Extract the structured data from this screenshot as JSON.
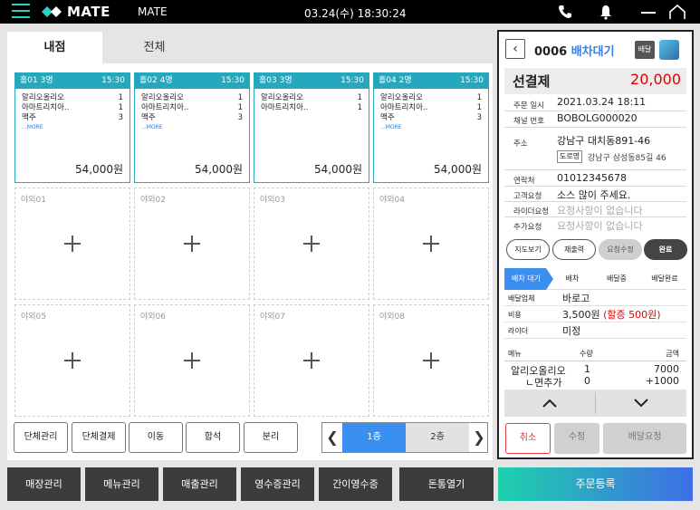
{
  "topbar": {
    "logo_text": "MATE",
    "store_name": "MATE",
    "datetime": "03.24(수) 18:30:24",
    "icons": [
      "menu-icon",
      "phone-icon",
      "bell-icon",
      "minimize-icon",
      "home-icon"
    ]
  },
  "tabs": {
    "inside": "내점",
    "all": "전체"
  },
  "occupied_tables": [
    {
      "name": "홀01 3명",
      "time": "15:30",
      "items": [
        {
          "n": "알리오올리오",
          "q": "1"
        },
        {
          "n": "아마트리치아..",
          "q": "1"
        },
        {
          "n": "맥주",
          "q": "3"
        }
      ],
      "more": "...MORE",
      "total": "54,000원"
    },
    {
      "name": "홀02 4명",
      "time": "15:30",
      "items": [
        {
          "n": "알리오올리오",
          "q": "1"
        },
        {
          "n": "아마트리치아..",
          "q": "1"
        },
        {
          "n": "맥주",
          "q": "3"
        }
      ],
      "more": "...MORE",
      "total": "54,000원"
    },
    {
      "name": "홀03 3명",
      "time": "15:30",
      "items": [
        {
          "n": "알리오올리오",
          "q": "1"
        },
        {
          "n": "아마트리치아..",
          "q": "1"
        }
      ],
      "more": "",
      "total": "54,000원"
    },
    {
      "name": "홀04 2명",
      "time": "15:30",
      "items": [
        {
          "n": "알리오올리오",
          "q": "1"
        },
        {
          "n": "아마트리치아..",
          "q": "1"
        },
        {
          "n": "맥주",
          "q": "3"
        }
      ],
      "more": "...MORE",
      "total": "54,000원"
    }
  ],
  "empty_tables": [
    "야외01",
    "야외02",
    "야외03",
    "야외04",
    "야외05",
    "야외06",
    "야외07",
    "야외08"
  ],
  "table_actions": {
    "group_manage": "단체관리",
    "group_pay": "단체결제",
    "move": "이동",
    "merge": "합석",
    "split": "분리"
  },
  "floors": {
    "floor1": "1층",
    "floor2": "2층",
    "prev": "❮",
    "next": "❯"
  },
  "bottom_nav": {
    "store_manage": "매장관리",
    "menu_manage": "메뉴관리",
    "sales_manage": "매출관리",
    "receipt_manage": "영수증관리",
    "simple_receipt": "간이영수증",
    "open_drawer": "돈통열기",
    "order_register": "주문등록"
  },
  "panel": {
    "order_no": "0006",
    "order_status": "배차대기",
    "delivery_badge": "배달",
    "prepay_label": "선결제",
    "prepay_amount": "20,000",
    "order_time_label": "주문 일시",
    "order_time": "2021.03.24 18:11",
    "channel_label": "채널 번호",
    "channel": "BOBOLG000020",
    "address_label": "주소",
    "address_jibun": "강남구 대치동891-46",
    "road_tag": "도로명",
    "address_road": "강남구 삼성동85길 46",
    "contact_label": "연락처",
    "contact": "01012345678",
    "customer_req_label": "고객요청",
    "customer_req": "소스 많이 주세요.",
    "rider_req_label": "라이더요청",
    "rider_req": "요청사항이 없습니다",
    "extra_req_label": "추가요청",
    "extra_req": "요청사항이 없습니다",
    "btn_map": "지도보기",
    "btn_reprint": "재출력",
    "btn_req_edit": "요청수정",
    "btn_done": "완료",
    "steps": [
      "배차 대기",
      "배차",
      "배달중",
      "배달완료"
    ],
    "agency_label": "배달업체",
    "agency": "바로고",
    "fee_label": "비용",
    "fee": "3,500원",
    "surcharge": "(할증 500원)",
    "rider_label": "라이더",
    "rider": "미정",
    "menu_col": "메뉴",
    "qty_col": "수량",
    "amount_col": "금액",
    "menu_items": [
      {
        "name": "알리오올리오",
        "qty": "1",
        "amount": "7000"
      },
      {
        "name": "ㄴ면추가",
        "qty": "0",
        "amount": "+1000"
      }
    ],
    "btn_cancel": "취소",
    "btn_edit": "수정",
    "btn_delivery_request": "배달요청"
  },
  "colors": {
    "accent": "#25a7bd",
    "blue": "#3b8ff0",
    "red": "#e00000",
    "dark": "#3c3c3c"
  }
}
